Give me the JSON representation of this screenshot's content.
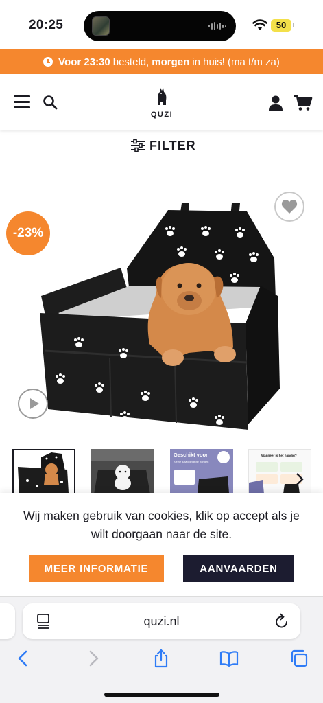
{
  "status_bar": {
    "time": "20:25",
    "battery": "50"
  },
  "promo": {
    "part1": "Voor 23:30",
    "part2": "besteld,",
    "part3": "morgen",
    "part4": "in huis! (ma t/m za)",
    "color": "#f5872e"
  },
  "header": {
    "logo_text": "QUZI",
    "icons": [
      "menu-icon",
      "search-icon",
      "account-icon",
      "cart-icon"
    ]
  },
  "filter": {
    "label": "FILTER"
  },
  "product": {
    "discount": "-23%",
    "icons": [
      "heart-icon",
      "play-icon"
    ]
  },
  "thumbnails": {
    "thumb3_title": "Geschikt voor",
    "thumb3_subtitle": "Kleine & Middelgrote honden",
    "thumb4_title": "Wanneer is het handig?"
  },
  "cookie": {
    "text": "Wij maken gebruik van cookies, klik op accept als je wilt doorgaan naar de site.",
    "more_label": "MEER INFORMATIE",
    "accept_label": "AANVAARDEN",
    "accent": "#f5872e",
    "dark": "#1c1c30"
  },
  "browser": {
    "url": "quzi.nl"
  }
}
